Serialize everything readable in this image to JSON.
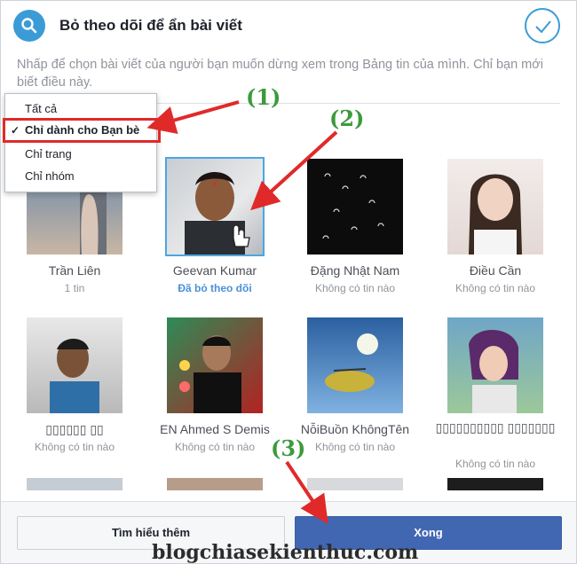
{
  "header": {
    "title": "Bỏ theo dõi để ẩn bài viết",
    "description": "Nhấp để chọn bài viết của người bạn muốn dừng xem trong Bảng tin của mình. Chỉ bạn mới biết điều này."
  },
  "filter": {
    "options": [
      "Tất cả",
      "Chỉ dành cho Bạn bè",
      "Chỉ trang",
      "Chỉ nhóm"
    ],
    "selected_index": 1,
    "check_glyph": "✓"
  },
  "people": [
    {
      "name": "Trần Liên",
      "status": "1 tin"
    },
    {
      "name": "Geevan Kumar",
      "status": "Đã bỏ theo dõi"
    },
    {
      "name": "Đặng Nhật Nam",
      "status": "Không có tin nào"
    },
    {
      "name": "Điều Cần",
      "status": "Không có tin nào"
    },
    {
      "name": "▯▯▯▯▯▯ ▯▯",
      "status": "Không có tin nào"
    },
    {
      "name": "EN Ahmed S Demis",
      "status": "Không có tin nào"
    },
    {
      "name": "NỗiBuồn KhôngTên",
      "status": "Không có tin nào"
    },
    {
      "name": "▯▯▯▯▯▯▯▯▯▯ ▯▯▯▯▯▯▯",
      "status": "Không có tin nào"
    }
  ],
  "footer": {
    "learn_more": "Tìm hiểu thêm",
    "done": "Xong"
  },
  "annotations": {
    "step1": "(1)",
    "step2": "(2)",
    "step3": "(3)"
  },
  "watermark": "blogchiasekienthuc.com",
  "colors": {
    "accent": "#3b9bd6",
    "primary_button": "#4267b2",
    "arrow": "#e02a2a",
    "step_label": "#3c9a3c"
  }
}
